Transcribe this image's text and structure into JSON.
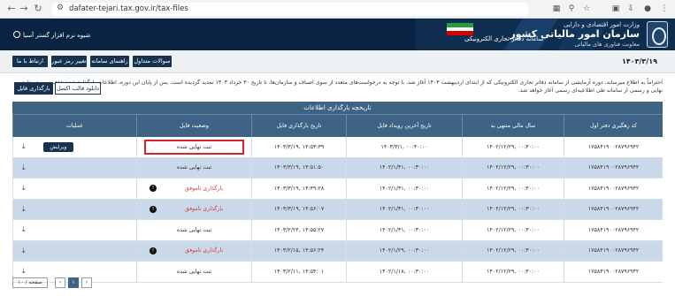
{
  "browser": {
    "url": "dafater-tejari.tax.gov.ir/tax-files"
  },
  "banner": {
    "ministry": "وزارت امور اقتصادی و دارایی",
    "org": "سازمان امور مالیاتی کشور",
    "deputy": "معاونت فناوری های مالیاتی",
    "system": "سامانه دفاتر تجاری الکترونیکی",
    "user": "شیوه نرم افزار گستر آسیا"
  },
  "nav": {
    "faq": "سوالات متداول",
    "guide": "راهنمای سامانه",
    "change_password": "تغییر رمز عبور",
    "contact": "ارتباط با ما"
  },
  "date": "۱۴۰۳/۳/۱۹",
  "notice": "احتراماً به اطلاع میرساند، دوره آزمایشی از سامانه دفاتر تجاری الکترونیکی که از ابتدای اردیبهشت ۱۴۰۳ آغاز شد، با توجه به درخواست‌های متعدد از سوی اصناف و سازمان‌ها، تا تاریخ ۳۰ خرداد ۱۴۰۳ تمدید گردیده است. پس از پایان این دوره، اطلاعات بارگذاری‌شده حذف و بهره‌برداری نهایی و رسمی از سامانه طی اطلاعیه‌ای رسمی آغاز خواهد شد.",
  "tabs": {
    "upload": "بارگذاری فایل",
    "download_template": "دانلود قالب اکسل"
  },
  "table": {
    "title": "تاریخچه بارگذاری اطلاعات",
    "headers": {
      "code": "کد رهگیری دفتر اول",
      "year": "سال مالی منتهی به",
      "last_entry": "تاریخ آخرین رویداد فایل",
      "upload": "تاریخ بارگذاری فایل",
      "status": "وضعیت فایل",
      "ops": "عملیات"
    },
    "edit_label": "ویرایش",
    "rows": [
      {
        "code": "۱۷۵۸۴۱۹۰۰۲۸۷۹۶۹۴۲",
        "year": "۱۴۰۲/۱۲/۲۹, ۰۰:۳۰:۰۰",
        "last": "۱۴۰۳/۳/۱, ۰۰:۳۰:۰۰",
        "upload": "۱۴۰۳/۳/۱۹, ۱۴:۵۳:۳۹",
        "status": "ثبت نهایی شده",
        "state": "final",
        "edit": true
      },
      {
        "code": "۱۷۵۸۴۱۹۰۰۲۸۷۹۶۹۴۲",
        "year": "۱۴۰۲/۱۲/۲۹, ۰۰:۳۰:۰۰",
        "last": "۱۴۰۲/۱/۳۱, ۰۰:۳۰:۰۰",
        "upload": "۱۴۰۳/۳/۱۹, ۱۴:۵۱:۵۰",
        "status": "ثبت نهایی شده",
        "state": "final",
        "edit": false
      },
      {
        "code": "۱۷۵۸۴۱۹۰۰۲۸۷۹۶۹۴۲",
        "year": "۱۴۰۲/۱۲/۲۹, ۰۰:۳۰:۰۰",
        "last": "۱۴۰۲/۱/۳۱, ۰۰:۳۰:۰۰",
        "upload": "۱۴۰۳/۳/۱۹, ۱۴:۴۹:۲۸",
        "status": "بارگذاری ناموفق",
        "state": "failed",
        "edit": false
      },
      {
        "code": "۱۷۵۸۴۱۹۰۰۲۸۷۹۶۹۴۲",
        "year": "۱۴۰۲/۱۲/۲۹, ۰۰:۳۰:۰۰",
        "last": "۱۴۰۲/۱/۳۱, ۰۰:۳۰:۰۰",
        "upload": "۱۴۰۳/۳/۱۹, ۱۴:۵۶:۰۷",
        "status": "بارگذاری ناموفق",
        "state": "failed",
        "edit": false
      },
      {
        "code": "۱۷۵۸۴۱۹۰۰۲۸۷۹۶۹۴۲",
        "year": "۱۴۰۲/۱۲/۲۹, ۰۰:۳۰:۰۰",
        "last": "۱۴۰۲/۱/۳۱, ۰۰:۳۰:۰۰",
        "upload": "۱۴۰۳/۲/۲۴, ۱۴:۵۵:۲۷",
        "status": "ثبت نهایی شده",
        "state": "final",
        "edit": false
      },
      {
        "code": "۱۷۵۸۴۱۹۰۰۲۸۷۹۶۹۴۲",
        "year": "۱۴۰۲/۱۲/۲۹, ۰۰:۳۰:۰۰",
        "last": "۱۴۰۲/۱/۲۹, ۰۰:۳۰:۰۰",
        "upload": "۱۴۰۳/۲/۱۵, ۱۴:۵۶:۲۴",
        "status": "بارگذاری ناموفق",
        "state": "failed",
        "edit": false
      },
      {
        "code": "۱۷۵۸۴۱۹۰۰۲۸۷۹۶۹۴۲",
        "year": "۱۴۰۲/۱۲/۲۹, ۰۰:۳۰:۰۰",
        "last": "۱۴۰۲/۱/۱۸, ۰۰:۳۰:۰۰",
        "upload": "۱۴۰۳/۲/۱۱, ۱۴:۵۴:۰۱",
        "status": "ثبت نهایی شده",
        "state": "final",
        "edit": false
      }
    ]
  },
  "pager": {
    "page_size": "۱۰ / صفحه",
    "current": "۱"
  }
}
